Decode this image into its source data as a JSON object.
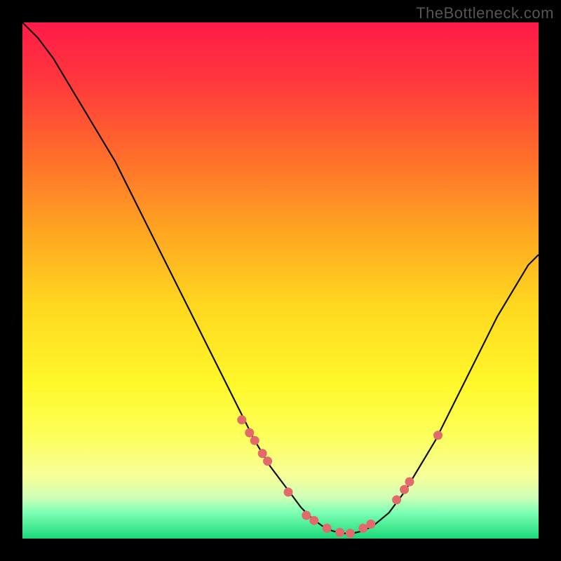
{
  "watermark": "TheBottleneck.com",
  "colors": {
    "dot": "#e26a6a",
    "curve": "#111111"
  },
  "chart_data": {
    "type": "line",
    "title": "",
    "xlabel": "",
    "ylabel": "",
    "xlim": [
      0,
      100
    ],
    "ylim": [
      0,
      100
    ],
    "series": [
      {
        "name": "bottleneck-curve",
        "x": [
          0,
          3,
          6,
          9,
          12,
          15,
          18,
          21,
          24,
          27,
          30,
          33,
          36,
          39,
          42,
          45,
          48,
          51,
          54,
          56,
          58,
          60,
          62,
          64,
          66,
          68,
          71,
          74,
          77,
          80,
          83,
          86,
          89,
          92,
          95,
          98,
          100
        ],
        "y": [
          100,
          97,
          93,
          88,
          83,
          78,
          73,
          67,
          61,
          55,
          49,
          43,
          37,
          31,
          25,
          19,
          14,
          10,
          6,
          4,
          2.5,
          1.5,
          1,
          1,
          1.5,
          2.5,
          5,
          9,
          14,
          19,
          25,
          31,
          37,
          43,
          48,
          53,
          55
        ]
      }
    ],
    "highlight_points": {
      "name": "marked-points",
      "x": [
        42.5,
        44,
        45,
        46.5,
        47.5,
        51.5,
        55,
        56.5,
        59,
        61.5,
        63.5,
        66,
        67.5,
        72.5,
        74,
        75,
        80.5
      ],
      "y": [
        23,
        20.5,
        19,
        16.5,
        15,
        9,
        4.5,
        3.5,
        2,
        1.2,
        1,
        2,
        2.8,
        7.5,
        9.5,
        11,
        20
      ]
    }
  }
}
